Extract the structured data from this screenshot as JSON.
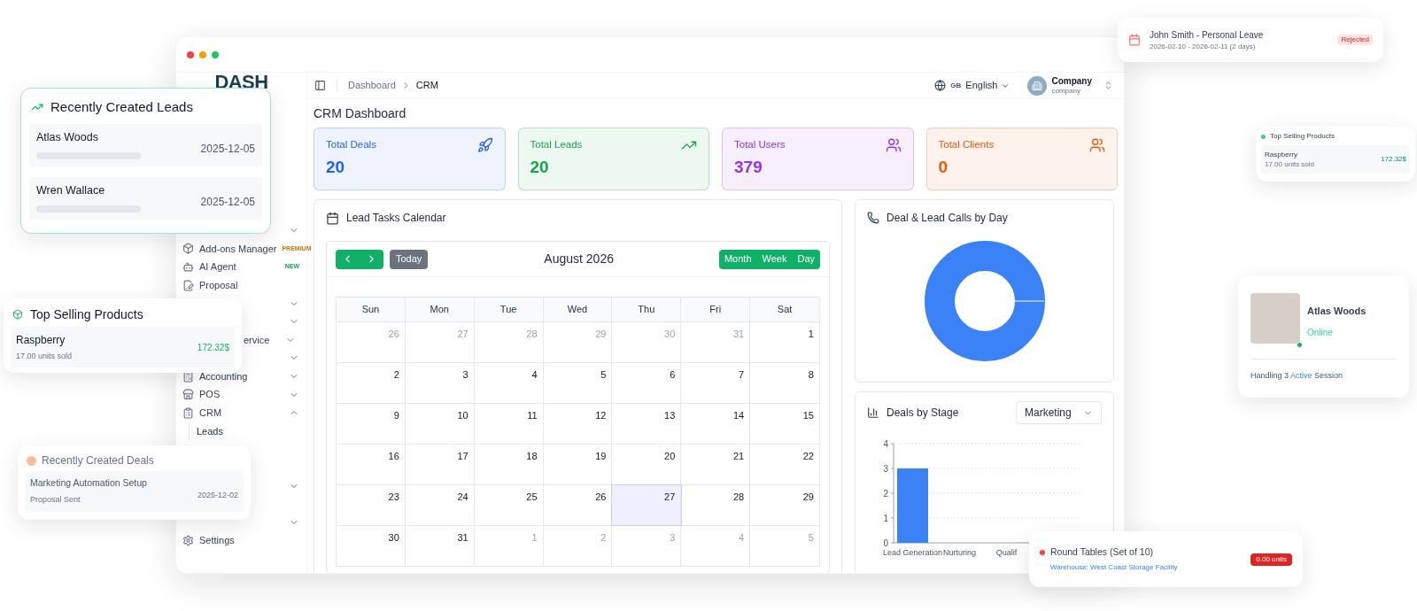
{
  "window": {
    "logo": "DASH"
  },
  "header": {
    "breadcrumbs": [
      "Dashboard",
      "CRM"
    ],
    "language": {
      "flag": "GB",
      "label": "English"
    },
    "account": {
      "name": "Company",
      "role": "company"
    }
  },
  "sidebar": {
    "items": [
      {
        "kind": "item",
        "expanded": false
      },
      {
        "kind": "item",
        "label": "Add-ons Manager",
        "badge": "PREMIUM",
        "color": "#c2780a"
      },
      {
        "kind": "item",
        "label": "AI Agent",
        "badge": "NEW",
        "color": "#16a34a"
      },
      {
        "kind": "item",
        "label": "Proposal"
      },
      {
        "kind": "item",
        "expanded": false
      },
      {
        "kind": "item",
        "expanded": false
      },
      {
        "kind": "partial",
        "label": "ervice",
        "expanded": false
      },
      {
        "kind": "item",
        "expanded": false
      },
      {
        "kind": "item",
        "label": "Accounting",
        "expanded": false
      },
      {
        "kind": "item",
        "label": "POS",
        "expanded": false
      },
      {
        "kind": "item",
        "label": "CRM",
        "expanded": true
      },
      {
        "kind": "sub",
        "label": "Leads"
      },
      {
        "kind": "gap"
      },
      {
        "kind": "gap"
      },
      {
        "kind": "item",
        "expanded": false
      },
      {
        "kind": "gap"
      },
      {
        "kind": "item",
        "expanded": false
      },
      {
        "kind": "item",
        "label": "Settings"
      }
    ]
  },
  "page_title": "CRM Dashboard",
  "stats": [
    {
      "label": "Total Deals",
      "value": "20",
      "color": "#2563eb"
    },
    {
      "label": "Total Leads",
      "value": "20",
      "color": "#16a34a"
    },
    {
      "label": "Total Users",
      "value": "379",
      "color": "#9333ea"
    },
    {
      "label": "Total Clients",
      "value": "0",
      "color": "#ea580c"
    }
  ],
  "calendar": {
    "title": "Lead Tasks Calendar",
    "today": "Today",
    "month": "August 2026",
    "views": [
      {
        "label": "Month",
        "selected": false
      },
      {
        "label": "Week",
        "selected": false
      },
      {
        "label": "Day",
        "selected": false
      }
    ],
    "weekdays": [
      "Sun",
      "Mon",
      "Tue",
      "Wed",
      "Thu",
      "Fri",
      "Sat"
    ],
    "weeks": [
      [
        {
          "day": "26",
          "muted": true,
          "selected": false
        },
        {
          "day": "27",
          "muted": true,
          "selected": false
        },
        {
          "day": "28",
          "muted": true,
          "selected": false
        },
        {
          "day": "29",
          "muted": true,
          "selected": false
        },
        {
          "day": "30",
          "muted": true,
          "selected": false
        },
        {
          "day": "31",
          "muted": true,
          "selected": false
        },
        {
          "day": "1",
          "muted": false,
          "selected": false
        }
      ],
      [
        {
          "day": "2",
          "muted": false,
          "selected": false
        },
        {
          "day": "3",
          "muted": false,
          "selected": false
        },
        {
          "day": "4",
          "muted": false,
          "selected": false
        },
        {
          "day": "5",
          "muted": false,
          "selected": false
        },
        {
          "day": "6",
          "muted": false,
          "selected": false
        },
        {
          "day": "7",
          "muted": false,
          "selected": false
        },
        {
          "day": "8",
          "muted": false,
          "selected": false
        }
      ],
      [
        {
          "day": "9",
          "muted": false,
          "selected": false
        },
        {
          "day": "10",
          "muted": false,
          "selected": false
        },
        {
          "day": "11",
          "muted": false,
          "selected": false
        },
        {
          "day": "12",
          "muted": false,
          "selected": false
        },
        {
          "day": "13",
          "muted": false,
          "selected": false
        },
        {
          "day": "14",
          "muted": false,
          "selected": false
        },
        {
          "day": "15",
          "muted": false,
          "selected": false
        }
      ],
      [
        {
          "day": "16",
          "muted": false,
          "selected": false
        },
        {
          "day": "17",
          "muted": false,
          "selected": false
        },
        {
          "day": "18",
          "muted": false,
          "selected": false
        },
        {
          "day": "19",
          "muted": false,
          "selected": false
        },
        {
          "day": "20",
          "muted": false,
          "selected": false
        },
        {
          "day": "21",
          "muted": false,
          "selected": false
        },
        {
          "day": "22",
          "muted": false,
          "selected": false
        }
      ],
      [
        {
          "day": "23",
          "muted": false,
          "selected": false
        },
        {
          "day": "24",
          "muted": false,
          "selected": false
        },
        {
          "day": "25",
          "muted": false,
          "selected": false
        },
        {
          "day": "26",
          "muted": false,
          "selected": false
        },
        {
          "day": "27",
          "muted": false,
          "selected": true
        },
        {
          "day": "28",
          "muted": false,
          "selected": false
        },
        {
          "day": "29",
          "muted": false,
          "selected": false
        }
      ],
      [
        {
          "day": "30",
          "muted": false,
          "selected": false
        },
        {
          "day": "31",
          "muted": false,
          "selected": false
        },
        {
          "day": "1",
          "muted": true,
          "selected": false
        },
        {
          "day": "2",
          "muted": true,
          "selected": false
        },
        {
          "day": "3",
          "muted": true,
          "selected": false
        },
        {
          "day": "4",
          "muted": true,
          "selected": false
        },
        {
          "day": "5",
          "muted": true,
          "selected": false
        }
      ]
    ]
  },
  "calls_panel": {
    "title": "Deal & Lead Calls by Day"
  },
  "stage_panel": {
    "title": "Deals by Stage",
    "filter": "Marketing",
    "chart_data": {
      "type": "bar",
      "categories": [
        "Lead Generation",
        "Nurturing",
        "Qualif"
      ],
      "series": [
        {
          "color": "#3b82f6",
          "values": [
            3,
            0,
            0
          ]
        }
      ],
      "ylim": [
        0,
        4
      ],
      "yticks": [
        0,
        1,
        2,
        3,
        4
      ],
      "grid": true
    }
  },
  "overlays": {
    "recent_leads": {
      "title": "Recently Created Leads",
      "items": [
        {
          "name": "Atlas Woods",
          "date": "2025-12-05"
        },
        {
          "name": "Wren Wallace",
          "date": "2025-12-05"
        }
      ]
    },
    "top_products": {
      "title": "Top Selling Products",
      "items": [
        {
          "name": "Raspberry",
          "sold": "17.00 units sold",
          "amount": "172.32$"
        }
      ]
    },
    "recent_deals": {
      "title": "Recently Created Deals",
      "items": [
        {
          "name": "Marketing Automation Setup",
          "stage": "Proposal Sent",
          "date": "2025-12-02"
        }
      ]
    },
    "leave": {
      "title": "John Smith - Personal Leave",
      "dates": "2026-02-10 - 2026-02-11 (2 days)",
      "status": "Rejected"
    },
    "mini_products": {
      "title": "Top Selling Products",
      "items": [
        {
          "name": "Raspberry",
          "sold": "17.00 units sold",
          "amount": "172.32$"
        }
      ]
    },
    "agent": {
      "name": "Atlas Woods",
      "status": "Online",
      "online": true,
      "session": {
        "before": "Handling 3",
        "highlight": "Active",
        "after": "Session"
      }
    },
    "stock": {
      "title": "Round Tables (Set of 10)",
      "location": "Warehouse: West Coast Storage Facility",
      "quantity": "0.00 units"
    }
  }
}
